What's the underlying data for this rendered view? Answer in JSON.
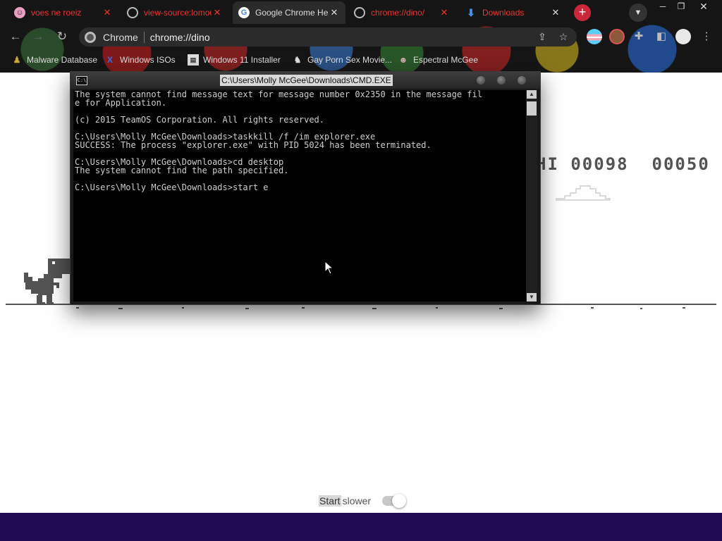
{
  "browser": {
    "tabs": [
      {
        "title": "voes ne roeiz",
        "active": false
      },
      {
        "title": "view-source:lomou",
        "active": false
      },
      {
        "title": "Google Chrome He",
        "active": true
      },
      {
        "title": "chrome://dino/",
        "active": false
      },
      {
        "title": "Downloads",
        "active": false
      }
    ],
    "omnibox": {
      "chip": "Chrome",
      "url": "chrome://dino"
    },
    "bookmarks": [
      {
        "label": "Malware Database"
      },
      {
        "label": "Windows ISOs"
      },
      {
        "label": "Windows 11 Installer"
      },
      {
        "label": "Gay Porn Sex Movie..."
      },
      {
        "label": "Espectral McGee"
      }
    ]
  },
  "game": {
    "score": "00050",
    "high_score": "00098",
    "hi_prefix": "HI",
    "slower_label_start": "Start",
    "slower_label_rest": " slower",
    "slower_enabled": true
  },
  "cmd": {
    "title": "C:\\Users\\Molly McGee\\Downloads\\CMD.EXE",
    "lines": [
      "The system cannot find message text for message number 0x2350 in the message fil",
      "e for Application.",
      "",
      "(c) 2015 TeamOS Corporation. All rights reserved.",
      "",
      "C:\\Users\\Molly McGee\\Downloads>taskkill /f /im explorer.exe",
      "SUCCESS: The process \"explorer.exe\" with PID 5024 has been terminated.",
      "",
      "C:\\Users\\Molly McGee\\Downloads>cd desktop",
      "The system cannot find the path specified.",
      "",
      "C:\\Users\\Molly McGee\\Downloads>start e"
    ]
  },
  "colors": {
    "tab_text": "#ee3333",
    "taskbar": "#1f0c55",
    "dino_gray": "#535353"
  }
}
